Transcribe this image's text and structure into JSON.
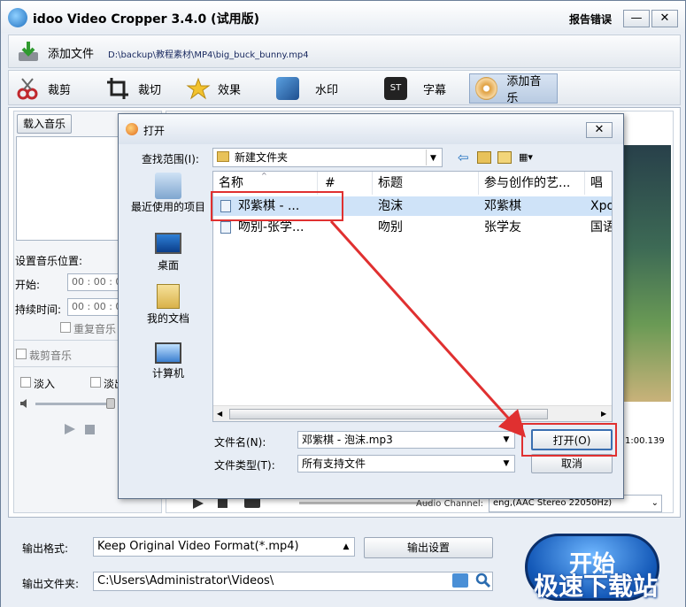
{
  "app": {
    "title": "idoo Video Cropper 3.4.0 (试用版)",
    "report": "报告错误",
    "minimize": "—",
    "close": "✕"
  },
  "toolbar1": {
    "add_file": "添加文件",
    "file_path": "D:\\backup\\教程素材\\MP4\\big_buck_bunny.mp4"
  },
  "tools": [
    {
      "label": "裁剪",
      "icon": "scissors-icon"
    },
    {
      "label": "裁切",
      "icon": "crop-icon"
    },
    {
      "label": "效果",
      "icon": "effects-icon"
    },
    {
      "label": "水印",
      "icon": "watermark-icon"
    },
    {
      "label": "字幕",
      "icon": "subtitle-icon"
    },
    {
      "label": "添加音乐",
      "icon": "music-icon"
    }
  ],
  "music_panel": {
    "load_music": "载入音乐",
    "set_position": "设置音乐位置:",
    "start_label": "开始:",
    "start_value": "00 : 00 : 00",
    "duration_label": "持续时间:",
    "duration_value": "00 : 00 : 00",
    "repeat_music": "重复音乐",
    "cut_music": "裁剪音乐",
    "fade_in": "淡入",
    "fade_out": "淡出"
  },
  "video": {
    "time": "1:00.139",
    "audio_channel_label": "Audio Channel:",
    "audio_channel_value": "eng,(AAC Stereo 22050Hz)"
  },
  "output": {
    "format_label": "输出格式:",
    "format_value": "Keep Original Video Format(*.mp4)",
    "settings": "输出设置",
    "folder_label": "输出文件夹:",
    "folder_value": "C:\\Users\\Administrator\\Videos\\",
    "start": "开始",
    "watermark": "极速下载站"
  },
  "dialog": {
    "title": "打开",
    "close": "✕",
    "lookin_label": "查找范围(I):",
    "lookin_value": "新建文件夹",
    "places": [
      "最近使用的项目",
      "桌面",
      "我的文档",
      "计算机"
    ],
    "columns": [
      "名称",
      "#",
      "标题",
      "参与创作的艺...",
      "唱片"
    ],
    "rows": [
      {
        "name": "邓紫棋 - ...",
        "num": "",
        "title": "泡沫",
        "artist": "邓紫棋",
        "album": "Xpo"
      },
      {
        "name": "吻别-张学...",
        "num": "",
        "title": "吻别",
        "artist": "张学友",
        "album": "国语"
      }
    ],
    "filename_label": "文件名(N):",
    "filename_value": "邓紫棋 - 泡沫.mp3",
    "filetype_label": "文件类型(T):",
    "filetype_value": "所有支持文件",
    "open": "打开(O)",
    "cancel": "取消"
  }
}
